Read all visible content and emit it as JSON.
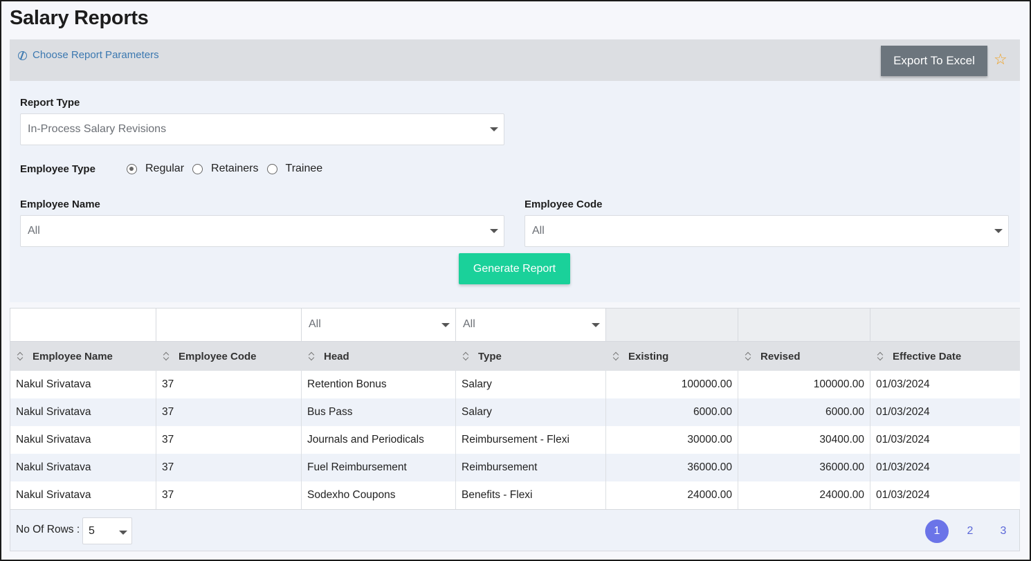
{
  "page": {
    "title": "Salary Reports"
  },
  "params": {
    "link_label": "Choose Report Parameters",
    "export_label": "Export To Excel"
  },
  "form": {
    "report_type_label": "Report Type",
    "report_type_value": "In-Process Salary Revisions",
    "employee_type_label": "Employee Type",
    "employee_types": [
      {
        "label": "Regular",
        "checked": true
      },
      {
        "label": "Retainers",
        "checked": false
      },
      {
        "label": "Trainee",
        "checked": false
      }
    ],
    "employee_name_label": "Employee Name",
    "employee_name_value": "All",
    "employee_code_label": "Employee Code",
    "employee_code_value": "All",
    "generate_label": "Generate Report"
  },
  "table": {
    "filters": [
      "",
      "",
      "All",
      "All",
      "",
      "",
      ""
    ],
    "columns": [
      "Employee Name",
      "Employee Code",
      "Head",
      "Type",
      "Existing",
      "Revised",
      "Effective Date"
    ],
    "rows": [
      [
        "Nakul Srivatava",
        "37",
        "Retention Bonus",
        "Salary",
        "100000.00",
        "100000.00",
        "01/03/2024"
      ],
      [
        "Nakul Srivatava",
        "37",
        "Bus Pass",
        "Salary",
        "6000.00",
        "6000.00",
        "01/03/2024"
      ],
      [
        "Nakul Srivatava",
        "37",
        "Journals and Periodicals",
        "Reimbursement - Flexi",
        "30000.00",
        "30400.00",
        "01/03/2024"
      ],
      [
        "Nakul Srivatava",
        "37",
        "Fuel Reimbursement",
        "Reimbursement",
        "36000.00",
        "36000.00",
        "01/03/2024"
      ],
      [
        "Nakul Srivatava",
        "37",
        "Sodexho Coupons",
        "Benefits - Flexi",
        "24000.00",
        "24000.00",
        "01/03/2024"
      ]
    ]
  },
  "footer": {
    "rows_label": "No Of Rows :",
    "rows_value": "5",
    "pages": [
      "1",
      "2",
      "3"
    ],
    "active_page": "1"
  },
  "colors": {
    "accent": "#1ad19a",
    "pager_active": "#6b74e8",
    "export_btn": "#6c757d"
  },
  "icons": [
    "pie-chart-icon",
    "star-icon",
    "sort-icon",
    "chevron-down-icon"
  ]
}
